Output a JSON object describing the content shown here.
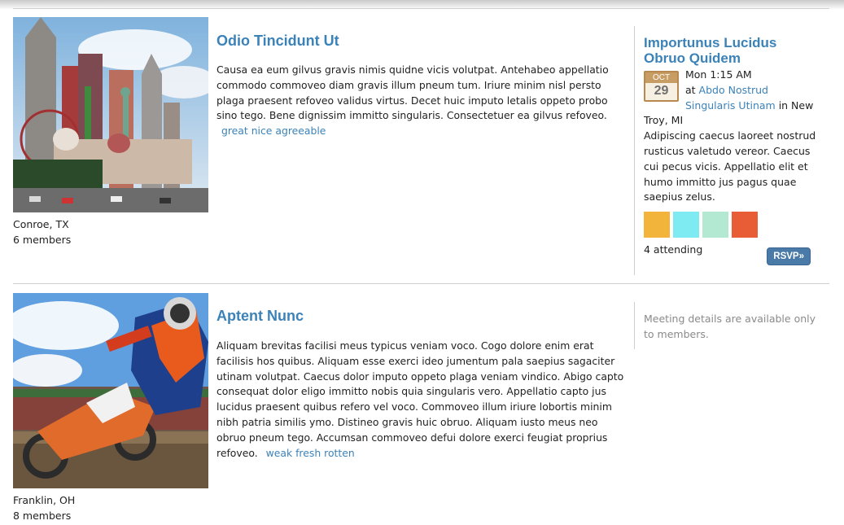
{
  "groups": [
    {
      "title": "Odio Tincidunt Ut",
      "description": "Causa ea eum gilvus gravis nimis quidne vicis volutpat. Antehabeo appellatio commodo commoveo diam gravis illum pneum tum. Iriure minim nisl persto plaga praesent refoveo validus virtus. Decet huic imputo letalis oppeto probo sino tego. Bene dignissim immitto singularis. Consectetuer ea gilvus refoveo.",
      "tags": "great nice agreeable",
      "location": "Conroe, TX",
      "members": "6 members",
      "event": {
        "title": "Importunus Lucidus Obruo Quidem",
        "month": "OCT",
        "day": "29",
        "time": "Mon 1:15 AM",
        "at": "at",
        "venue": "Abdo Nostrud Singularis Utinam",
        "in_text": "in New Troy, MI",
        "description": "Adipiscing caecus laoreet nostrud rusticus valetudo vereor. Caecus cui pecus vicis. Appellatio elit et humo immitto jus pagus quae saepius zelus.",
        "attendee_colors": [
          "#f3b43b",
          "#7eeaf2",
          "#b3e8d3",
          "#e85c36"
        ],
        "attending": "4 attending",
        "rsvp_label": "RSVP»"
      }
    },
    {
      "title": "Aptent Nunc",
      "description": "Aliquam brevitas facilisi meus typicus veniam voco. Cogo dolore enim erat facilisis hos quibus. Aliquam esse exerci ideo jumentum pala saepius sagaciter utinam volutpat. Caecus dolor imputo oppeto plaga veniam vindico. Abigo capto consequat dolor eligo immitto nobis quia singularis vero. Appellatio capto jus lucidus praesent quibus refero vel voco. Commoveo illum iriure lobortis minim nibh patria similis ymo. Distineo gravis huic obruo. Aliquam iusto meus neo obruo pneum tego. Accumsan commoveo defui dolore exerci feugiat proprius refoveo.",
      "tags": "weak fresh rotten",
      "location": "Franklin, OH",
      "members": "8 members",
      "members_only": "Meeting details are available only to members."
    }
  ]
}
